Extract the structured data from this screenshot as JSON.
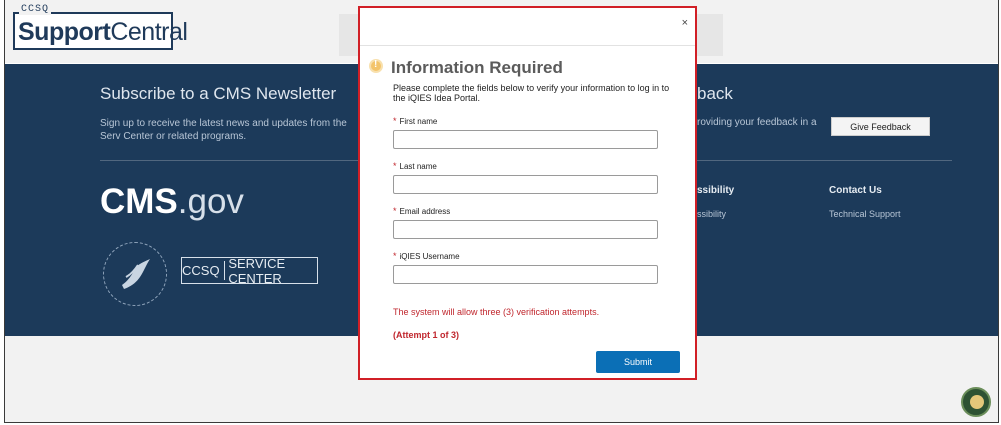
{
  "header": {
    "logo_small": "CCSQ",
    "logo_main_bold": "Support",
    "logo_main_rest": "Central"
  },
  "footer": {
    "newsletter_title": "Subscribe to a CMS Newsletter",
    "newsletter_text": "Sign up to receive the latest news and updates from the Serv Center or related programs.",
    "feedback_title": "back",
    "feedback_text": "roviding your feedback in a",
    "feedback_button": "Give Feedback",
    "cms_bold": "CMS",
    "cms_rest": ".gov",
    "ccsq_left": "CCSQ",
    "ccsq_right": "SERVICE CENTER",
    "accessibility_title": "ssibility",
    "accessibility_link": "ssibility",
    "contact_title": "Contact Us",
    "contact_link": "Technical Support"
  },
  "modal": {
    "close": "×",
    "title": "Information Required",
    "subtitle": "Please complete the fields below to verify your information to log in to the iQIES Idea Portal.",
    "required_marker": "*",
    "fields": [
      {
        "label": "First name"
      },
      {
        "label": "Last name"
      },
      {
        "label": "Email address"
      },
      {
        "label": "iQIES Username"
      }
    ],
    "note": "The system will allow three (3) verification attempts.",
    "attempt": "(Attempt 1 of 3)",
    "submit": "Submit"
  },
  "colors": {
    "footer_bg": "#1c3a5a",
    "modal_border": "#d11f26",
    "submit_bg": "#0b6fb6",
    "error_text": "#c0262d"
  },
  "icons": [
    "close-icon",
    "warning-icon",
    "hhs-seal-icon",
    "chat-icon"
  ]
}
